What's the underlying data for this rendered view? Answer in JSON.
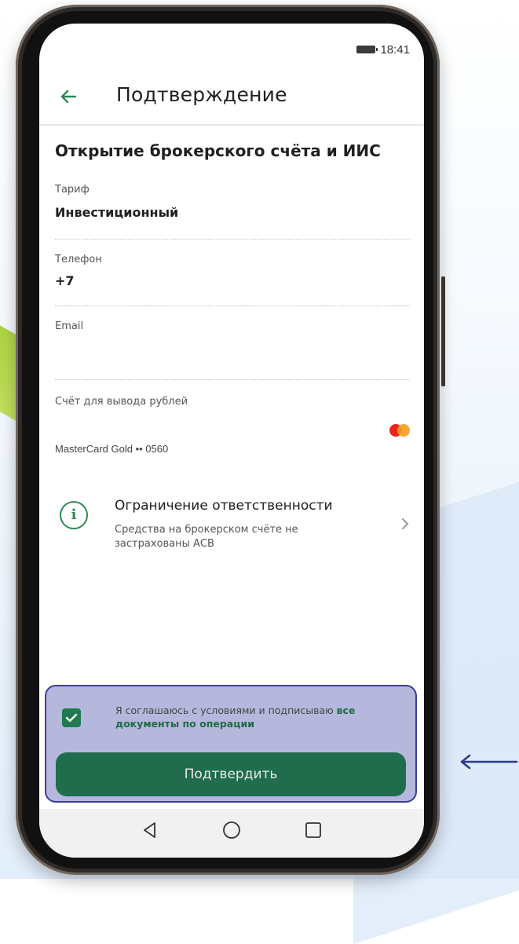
{
  "status_bar": {
    "time": "18:41"
  },
  "app_bar": {
    "title": "Подтверждение"
  },
  "section_title": "Открытие брокерского счёта и ИИС",
  "fields": [
    {
      "label": "Тариф",
      "value": "Инвестиционный"
    },
    {
      "label": "Телефон",
      "value": "+7"
    },
    {
      "label": "Email",
      "value": ""
    },
    {
      "label": "Счёт для вывода рублей",
      "value": "MasterCard Gold •• 0560"
    }
  ],
  "disclaimer": {
    "title": "Ограничение ответственности",
    "text": "Средства на брокерском счёте не застрахованы АСВ"
  },
  "agreement": {
    "text": "Я соглашаюсь с условиями и подписываю ",
    "link": "все документы по операции",
    "checked": true
  },
  "confirm_button": "Подтвердить",
  "colors": {
    "accent": "#1f6d4c",
    "highlight": "#b5b8dc",
    "highlight_border": "#3b3f9a"
  },
  "icons": [
    "back-arrow-icon",
    "battery-icon",
    "mastercard-icon",
    "info-icon",
    "chevron-right-icon",
    "check-icon",
    "nav-back-icon",
    "nav-home-icon",
    "nav-recents-icon",
    "pointer-arrow-icon"
  ]
}
